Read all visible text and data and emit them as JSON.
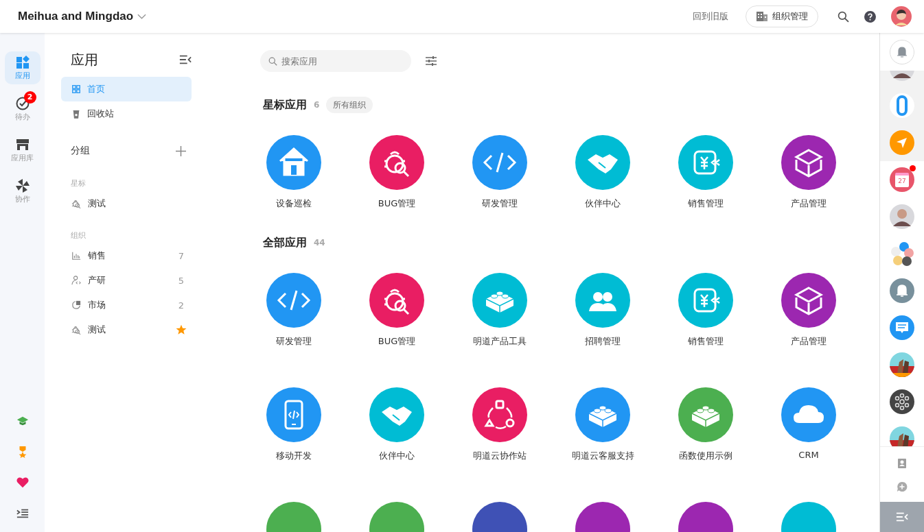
{
  "header": {
    "org_name": "Meihua and Mingdao",
    "old_version_link": "回到旧版",
    "org_admin_button": "组织管理"
  },
  "rail": {
    "items": [
      {
        "label": "应用",
        "kind": "apps",
        "selected": true
      },
      {
        "label": "待办",
        "kind": "check",
        "selected": false,
        "badge": "2"
      },
      {
        "label": "应用库",
        "kind": "store",
        "selected": false
      },
      {
        "label": "协作",
        "kind": "pinwheel",
        "selected": false
      }
    ]
  },
  "sidebar": {
    "title": "应用",
    "nav": [
      {
        "label": "首页",
        "kind": "grid",
        "selected": true
      },
      {
        "label": "回收站",
        "kind": "trash",
        "selected": false
      }
    ],
    "groups_title": "分组",
    "starred_title": "星标",
    "starred": [
      {
        "label": "测试",
        "kind": "bug"
      }
    ],
    "org_title": "组织",
    "groups": [
      {
        "label": "销售",
        "kind": "chart",
        "count": "7",
        "starred": false
      },
      {
        "label": "产研",
        "kind": "dev",
        "count": "5",
        "starred": false
      },
      {
        "label": "市场",
        "kind": "pie",
        "count": "2",
        "starred": false
      },
      {
        "label": "测试",
        "kind": "bug",
        "starred": true
      }
    ]
  },
  "main": {
    "search": {
      "placeholder": "搜索应用"
    },
    "sections": [
      {
        "title": "星标应用",
        "count": "6",
        "tag": "所有组织",
        "apps": [
          {
            "name": "设备巡检",
            "kind": "home",
            "color": "#2196f3"
          },
          {
            "name": "BUG管理",
            "kind": "bug",
            "color": "#e91e63"
          },
          {
            "name": "研发管理",
            "kind": "code",
            "color": "#2196f3"
          },
          {
            "name": "伙伴中心",
            "kind": "handshake",
            "color": "#00bcd4"
          },
          {
            "name": "销售管理",
            "kind": "sales",
            "color": "#00bcd4"
          },
          {
            "name": "产品管理",
            "kind": "box",
            "color": "#9c27b0"
          }
        ]
      },
      {
        "title": "全部应用",
        "count": "44",
        "apps": [
          {
            "name": "研发管理",
            "kind": "code",
            "color": "#2196f3"
          },
          {
            "name": "BUG管理",
            "kind": "bug",
            "color": "#e91e63"
          },
          {
            "name": "明道产品工具",
            "kind": "lego",
            "color": "#00bcd4"
          },
          {
            "name": "招聘管理",
            "kind": "people",
            "color": "#00bcd4"
          },
          {
            "name": "销售管理",
            "kind": "sales",
            "color": "#00bcd4"
          },
          {
            "name": "产品管理",
            "kind": "box",
            "color": "#9c27b0"
          },
          {
            "name": "移动开发",
            "kind": "mobile",
            "color": "#2196f3"
          },
          {
            "name": "伙伴中心",
            "kind": "handshake",
            "color": "#00bcd4"
          },
          {
            "name": "明道云协作站",
            "kind": "nodes",
            "color": "#e91e63"
          },
          {
            "name": "明道云客服支持",
            "kind": "lego",
            "color": "#2196f3"
          },
          {
            "name": "函数使用示例",
            "kind": "lego",
            "color": "#4caf50"
          },
          {
            "name": "CRM",
            "kind": "cloud",
            "color": "#2196f3"
          },
          {
            "color": "#4caf50"
          },
          {
            "color": "#4caf50"
          },
          {
            "color": "#3f51b5"
          },
          {
            "color": "#9c27b0"
          },
          {
            "color": "#9c27b0"
          },
          {
            "color": "#00bcd4"
          }
        ]
      }
    ]
  },
  "dock": {
    "items": [
      {
        "kind": "avatar",
        "pinned": true
      },
      {
        "kind": "ring",
        "pinned": true
      },
      {
        "kind": "send",
        "pinned": true
      },
      {
        "kind": "calendar",
        "day": "27",
        "dot": true,
        "pinned": false
      },
      {
        "kind": "avatar",
        "pinned": false
      },
      {
        "kind": "group",
        "pinned": false
      },
      {
        "kind": "bell",
        "pinned": false
      },
      {
        "kind": "message",
        "pinned": false
      },
      {
        "kind": "picture",
        "pinned": false
      },
      {
        "kind": "network",
        "pinned": false
      },
      {
        "kind": "picture",
        "pinned": false
      }
    ]
  }
}
